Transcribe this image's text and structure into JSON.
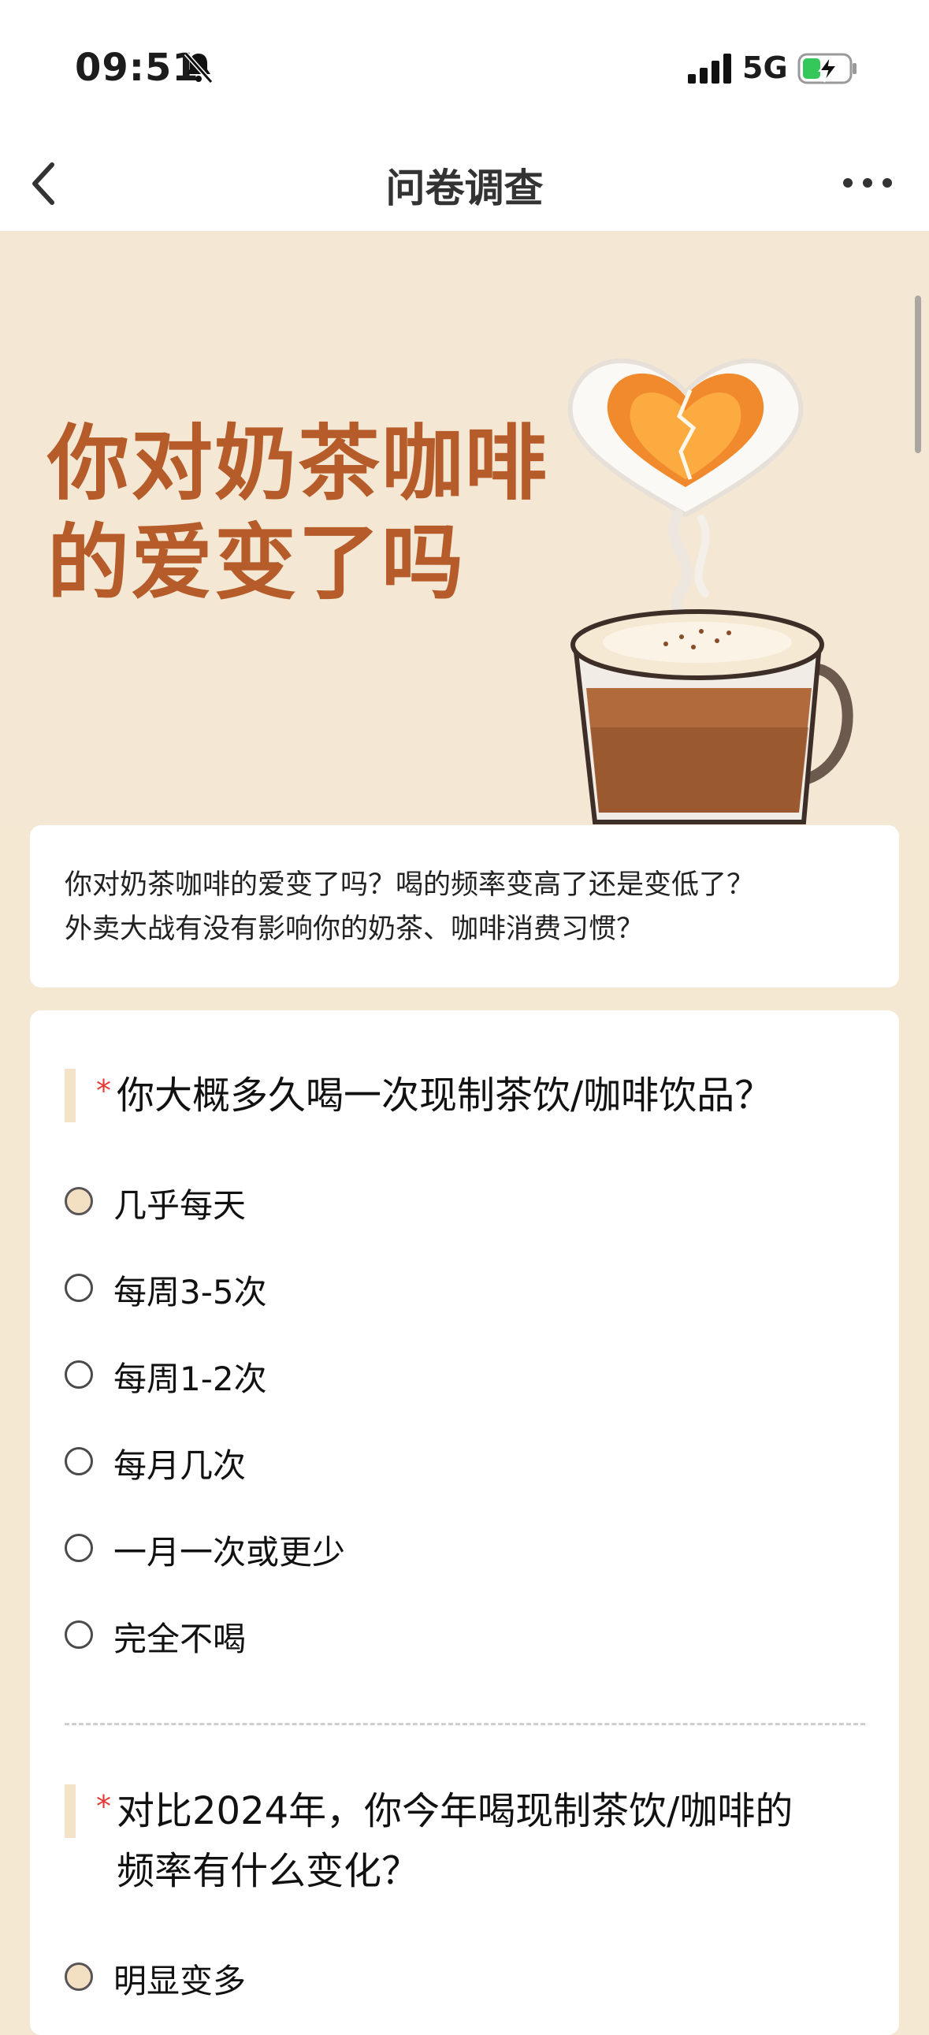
{
  "status_bar": {
    "time": "09:51",
    "network": "5G",
    "icons": [
      "bell-slash-icon",
      "signal-bars-icon",
      "battery-charging-icon"
    ]
  },
  "nav": {
    "title": "问卷调查",
    "back_icon": "chevron-left-icon",
    "more_icon": "ellipsis-icon"
  },
  "banner": {
    "title_lines": [
      "你对奶茶咖啡",
      "的爱变了吗"
    ],
    "illustration": "coffee-cup-broken-heart-steam"
  },
  "intro": {
    "lines": [
      "你对奶茶咖啡的爱变了吗？喝的频率变高了还是变低了？",
      "外卖大战有没有影响你的奶茶、咖啡消费习惯？"
    ]
  },
  "questions": [
    {
      "required_mark": "*",
      "text": "你大概多久喝一次现制茶饮/咖啡饮品？",
      "options": [
        "几乎每天",
        "每周3-5次",
        "每周1-2次",
        "每月几次",
        "一月一次或更少",
        "完全不喝"
      ]
    },
    {
      "required_mark": "*",
      "text_lines": [
        "对比2024年，你今年喝现制茶饮/咖啡的",
        "频率有什么变化？"
      ],
      "options": [
        "明显变多"
      ]
    }
  ],
  "colors": {
    "banner_bg": "#f4e8d5",
    "title_brown": "#b65c2a",
    "required_red": "#e53935",
    "accent_bar": "#f3e3c8"
  }
}
